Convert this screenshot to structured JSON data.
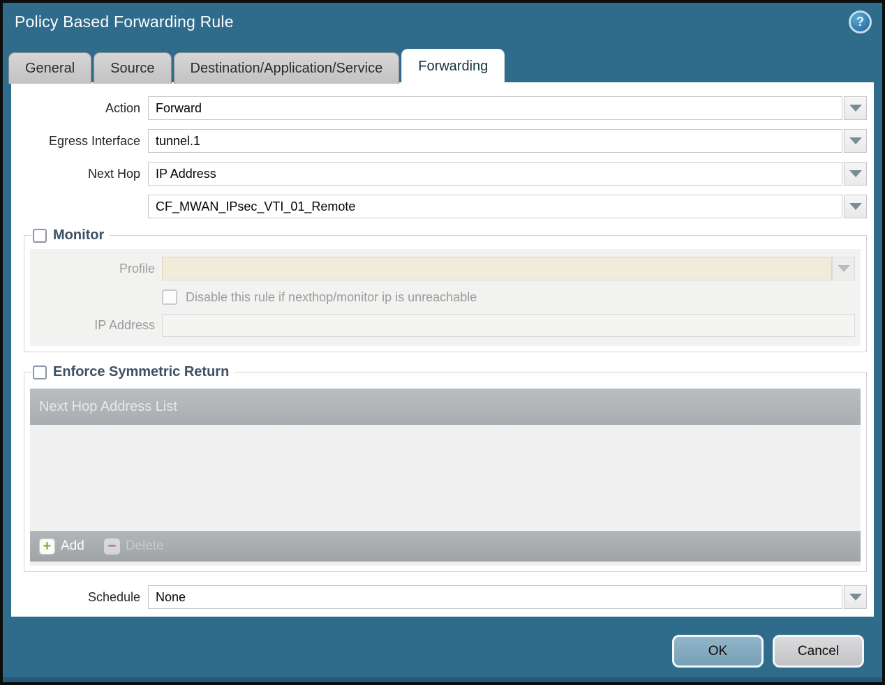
{
  "dialog": {
    "title": "Policy Based Forwarding Rule",
    "help": "?"
  },
  "tabs": [
    {
      "label": "General",
      "active": false
    },
    {
      "label": "Source",
      "active": false
    },
    {
      "label": "Destination/Application/Service",
      "active": false
    },
    {
      "label": "Forwarding",
      "active": true
    }
  ],
  "form": {
    "action": {
      "label": "Action",
      "value": "Forward"
    },
    "egress_interface": {
      "label": "Egress Interface",
      "value": "tunnel.1"
    },
    "next_hop": {
      "label": "Next Hop",
      "value": "IP Address"
    },
    "next_hop_address": {
      "value": "CF_MWAN_IPsec_VTI_01_Remote"
    },
    "schedule": {
      "label": "Schedule",
      "value": "None"
    }
  },
  "monitor": {
    "legend": "Monitor",
    "checked": false,
    "profile": {
      "label": "Profile",
      "value": ""
    },
    "disable_rule": {
      "label": "Disable this rule if nexthop/monitor ip is unreachable",
      "checked": false
    },
    "ip_address": {
      "label": "IP Address",
      "value": ""
    }
  },
  "symmetric_return": {
    "legend": "Enforce Symmetric Return",
    "checked": false,
    "table": {
      "header": "Next Hop Address List",
      "rows": []
    },
    "add_label": "Add",
    "delete_label": "Delete"
  },
  "footer": {
    "ok_label": "OK",
    "cancel_label": "Cancel"
  },
  "colors": {
    "titlebar": "#2f6b8b",
    "active_tab": "#ffffff",
    "monitor_profile_field": "#f1ecd9",
    "table_header": "#aeb2b5",
    "ok_button": "#80a9bd",
    "add_icon_green": "#8ca839",
    "delete_icon_red": "#aa6d55"
  }
}
